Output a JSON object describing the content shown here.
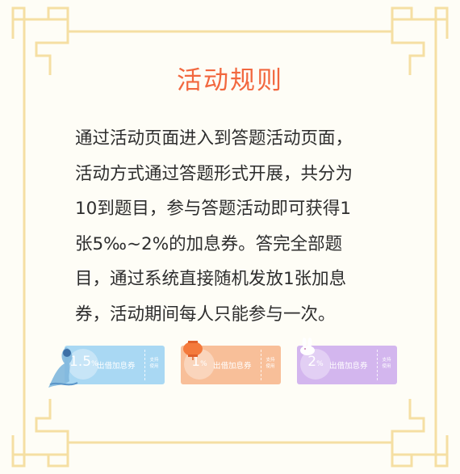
{
  "title": "活动规则",
  "rules_lines": [
    "通过活动页面进入到答题活动页面，",
    "活动方式通过答题形式开展，共分为",
    "10到题目，参与答题活动即可获得1",
    "张5‰~2%的加息券。答完全部题",
    "目，通过系统直接随机发放1张加息",
    "券，活动期间每人只能参与一次。"
  ],
  "coupons": [
    {
      "value": "1.5",
      "unit": "%",
      "label": "出借加息券",
      "side_text": "支持使用",
      "color": "#a9d8f3"
    },
    {
      "value": "1",
      "unit": "%",
      "label": "出借加息券",
      "side_text": "支持使用",
      "color": "#f8bf99"
    },
    {
      "value": "2",
      "unit": "%",
      "label": "出借加息券",
      "side_text": "支持使用",
      "color": "#d3b6ee"
    }
  ],
  "colors": {
    "border": "#f5dfa3",
    "title": "#f2683f",
    "background": "#fefdf6"
  }
}
